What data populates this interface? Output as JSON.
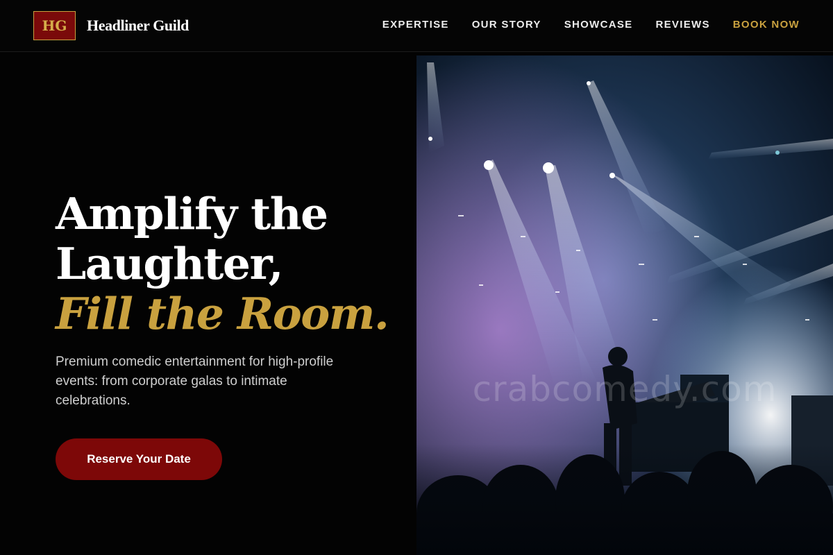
{
  "brand": {
    "mark": "HG",
    "name": "Headliner Guild"
  },
  "nav": {
    "items": [
      {
        "label": "EXPERTISE"
      },
      {
        "label": "OUR STORY"
      },
      {
        "label": "SHOWCASE"
      },
      {
        "label": "REVIEWS"
      }
    ],
    "cta_label": "BOOK NOW"
  },
  "hero": {
    "title_line1": "Amplify the",
    "title_line2": "Laughter,",
    "title_accent": "Fill the Room.",
    "subtitle": "Premium comedic entertainment for high-profile events: from corporate galas to intimate celebrations.",
    "cta_label": "Reserve Your Date",
    "watermark": "crabcomedy.com"
  },
  "colors": {
    "background": "#030303",
    "accent_gold": "#c9a13f",
    "cta_red": "#7d0808"
  }
}
